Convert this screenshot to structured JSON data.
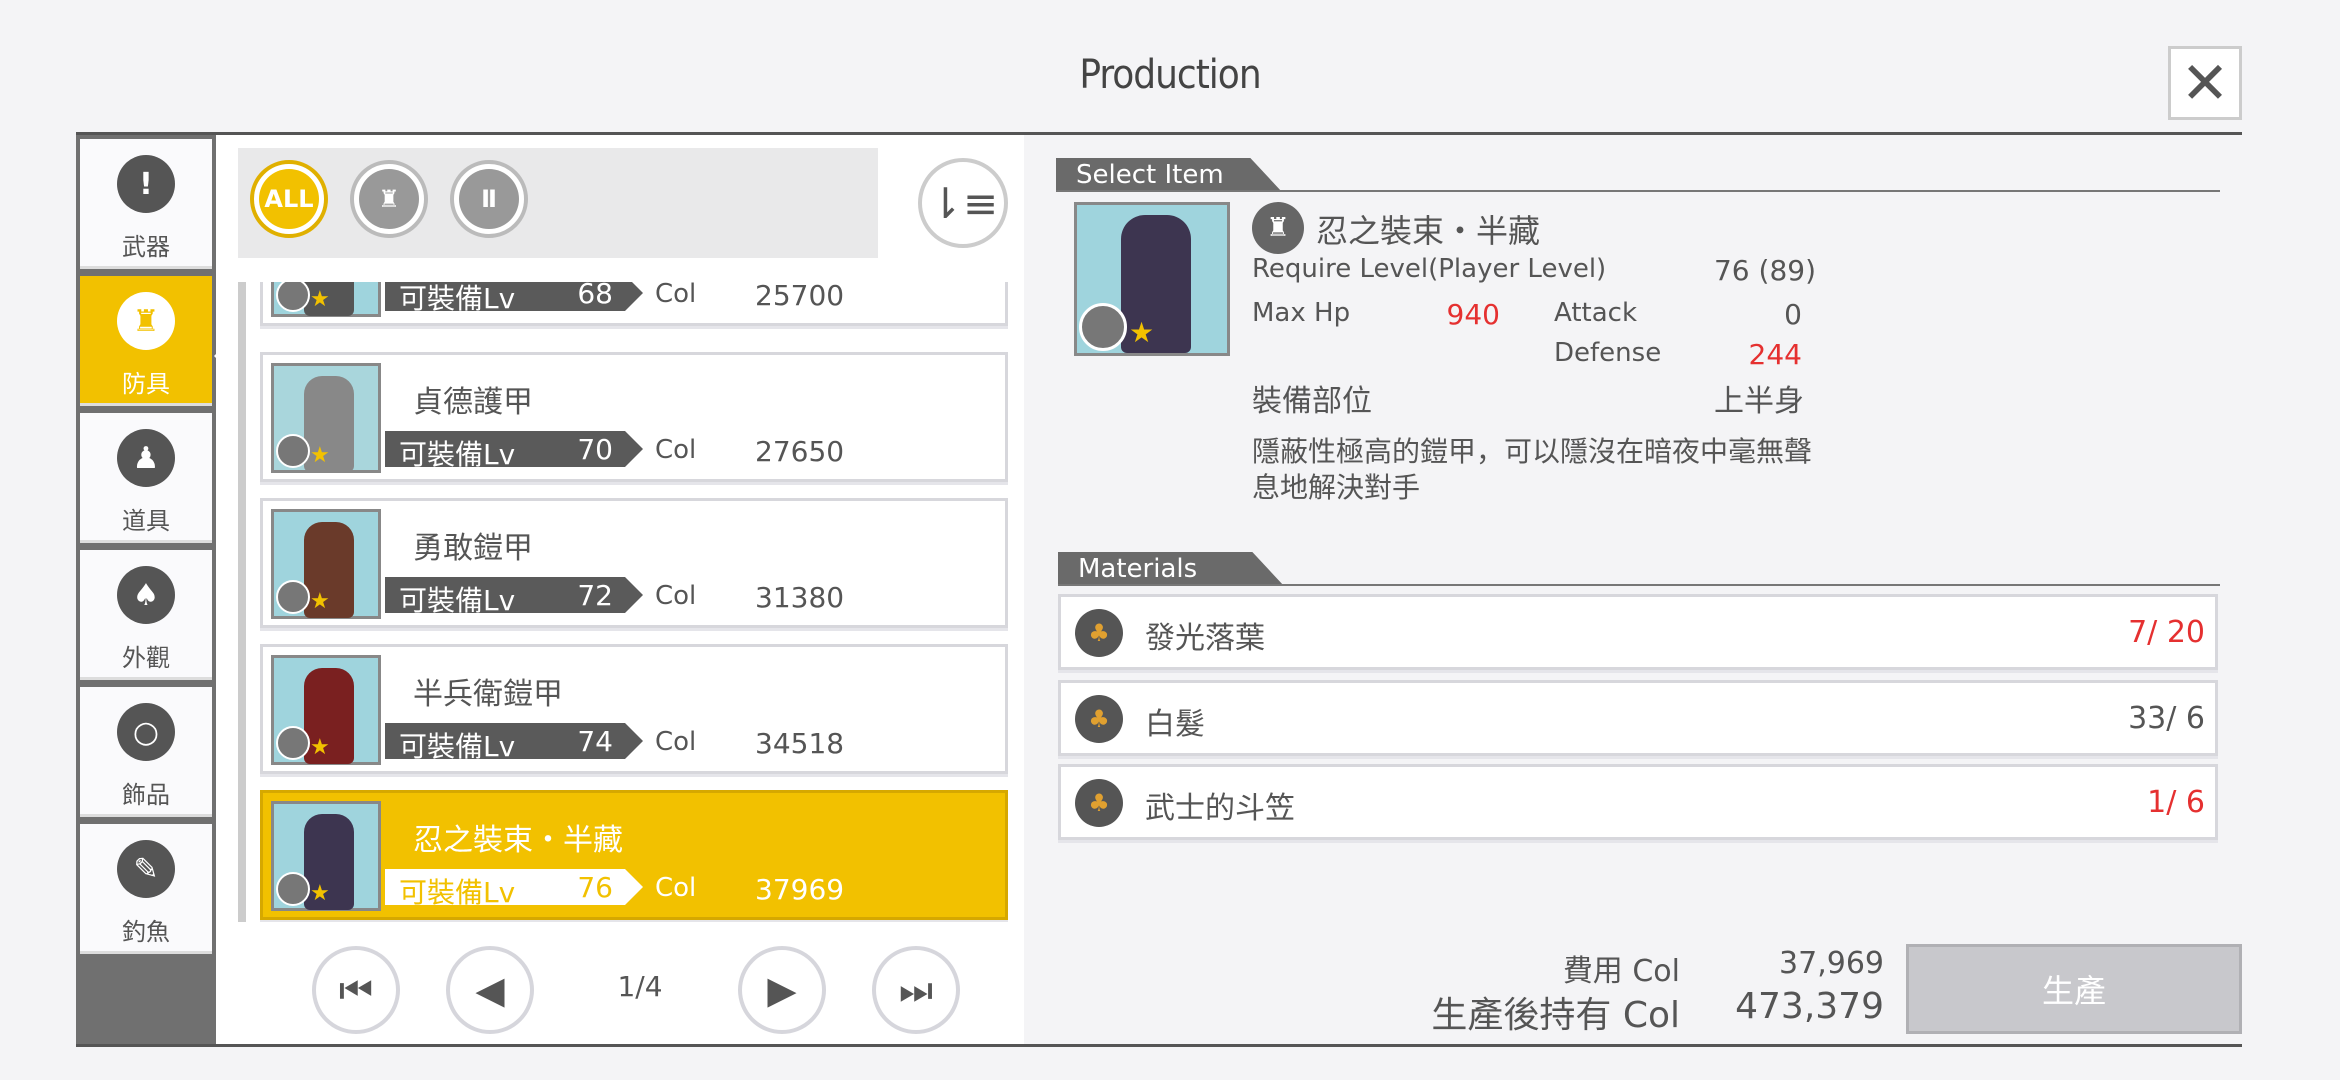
{
  "title": "Production",
  "close_label": "✕",
  "categories": [
    {
      "label": "武器",
      "icon": "sword-icon"
    },
    {
      "label": "防具",
      "icon": "armor-icon"
    },
    {
      "label": "道具",
      "icon": "potion-icon"
    },
    {
      "label": "外觀",
      "icon": "costume-icon"
    },
    {
      "label": "飾品",
      "icon": "ring-icon"
    },
    {
      "label": "釣魚",
      "icon": "fishing-icon"
    }
  ],
  "filters": [
    {
      "label": "ALL",
      "icon": "all-icon"
    },
    {
      "label": "",
      "icon": "body-armor-icon"
    },
    {
      "label": "",
      "icon": "leg-armor-icon"
    }
  ],
  "list": {
    "items": [
      {
        "name": "",
        "lv_label": "可裝備Lv",
        "lv": "68",
        "col_label": "Col",
        "col": "25700"
      },
      {
        "name": "貞德護甲",
        "lv_label": "可裝備Lv",
        "lv": "70",
        "col_label": "Col",
        "col": "27650"
      },
      {
        "name": "勇敢鎧甲",
        "lv_label": "可裝備Lv",
        "lv": "72",
        "col_label": "Col",
        "col": "31380"
      },
      {
        "name": "半兵衛鎧甲",
        "lv_label": "可裝備Lv",
        "lv": "74",
        "col_label": "Col",
        "col": "34518"
      },
      {
        "name": "忍之裝束・半藏",
        "lv_label": "可裝備Lv",
        "lv": "76",
        "col_label": "Col",
        "col": "37969"
      }
    ],
    "page": "1/4"
  },
  "select_item": {
    "header": "Select Item",
    "name": "忍之裝束・半藏",
    "require_label": "Require Level(Player Level)",
    "require_value": "76 (89)",
    "maxhp_label": "Max Hp",
    "maxhp_value": "940",
    "attack_label": "Attack",
    "attack_value": "0",
    "defense_label": "Defense",
    "defense_value": "244",
    "slot_label": "裝備部位",
    "slot_value": "上半身",
    "description": "隱蔽性極高的鎧甲，可以隱沒在暗夜中毫無聲息地解決對手"
  },
  "materials": {
    "header": "Materials",
    "items": [
      {
        "name": "發光落葉",
        "count": "7/ 20",
        "insufficient": true
      },
      {
        "name": "白髮",
        "count": "33/ 6",
        "insufficient": false
      },
      {
        "name": "武士的斗笠",
        "count": "1/ 6",
        "insufficient": true
      }
    ]
  },
  "cost": {
    "fee_label": "費用 Col",
    "fee_value": "37,969",
    "after_label": "生產後持有 Col",
    "after_value": "473,379"
  },
  "produce_label": "生產",
  "colors": {
    "accent": "#f2c100",
    "warning": "#e53030",
    "dark": "#5a5a5a"
  }
}
